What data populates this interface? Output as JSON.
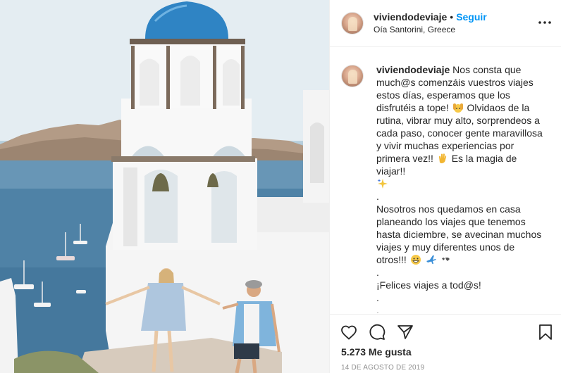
{
  "post": {
    "username": "viviendodeviaje",
    "separator": "•",
    "follow_label": "Seguir",
    "location": "Oía Santorini, Greece",
    "caption_lines": [
      "Nos consta que",
      "much@s comenzáis vuestros viajes",
      "estos días, esperamos que los",
      "disfrutéis a tope!",
      "Olvidaos de la",
      "rutina, vibrar muy alto, sorprendeos a",
      "cada paso, conocer gente maravillosa",
      "y vivir muchas experiencias por",
      "primera vez!!",
      "Es la magia de viajar!!",
      ".",
      "Nosotros nos quedamos en casa",
      "planeando los viajes que tenemos",
      "hasta diciembre, se avecinan muchos",
      "viajes y muy diferentes unos de",
      "otros!!!",
      ".",
      "¡Felices viajes a tod@s!",
      ".",
      "."
    ],
    "likes": "5.273 Me gusta",
    "date": "14 DE AGOSTO DE 2019"
  },
  "icons": {
    "more": "more-options-icon",
    "like": "heart-icon",
    "comment": "comment-icon",
    "share": "share-icon",
    "save": "bookmark-icon"
  },
  "colors": {
    "accent": "#0095f6",
    "text": "#262626",
    "muted": "#8e8e8e",
    "divider": "#efefef"
  }
}
